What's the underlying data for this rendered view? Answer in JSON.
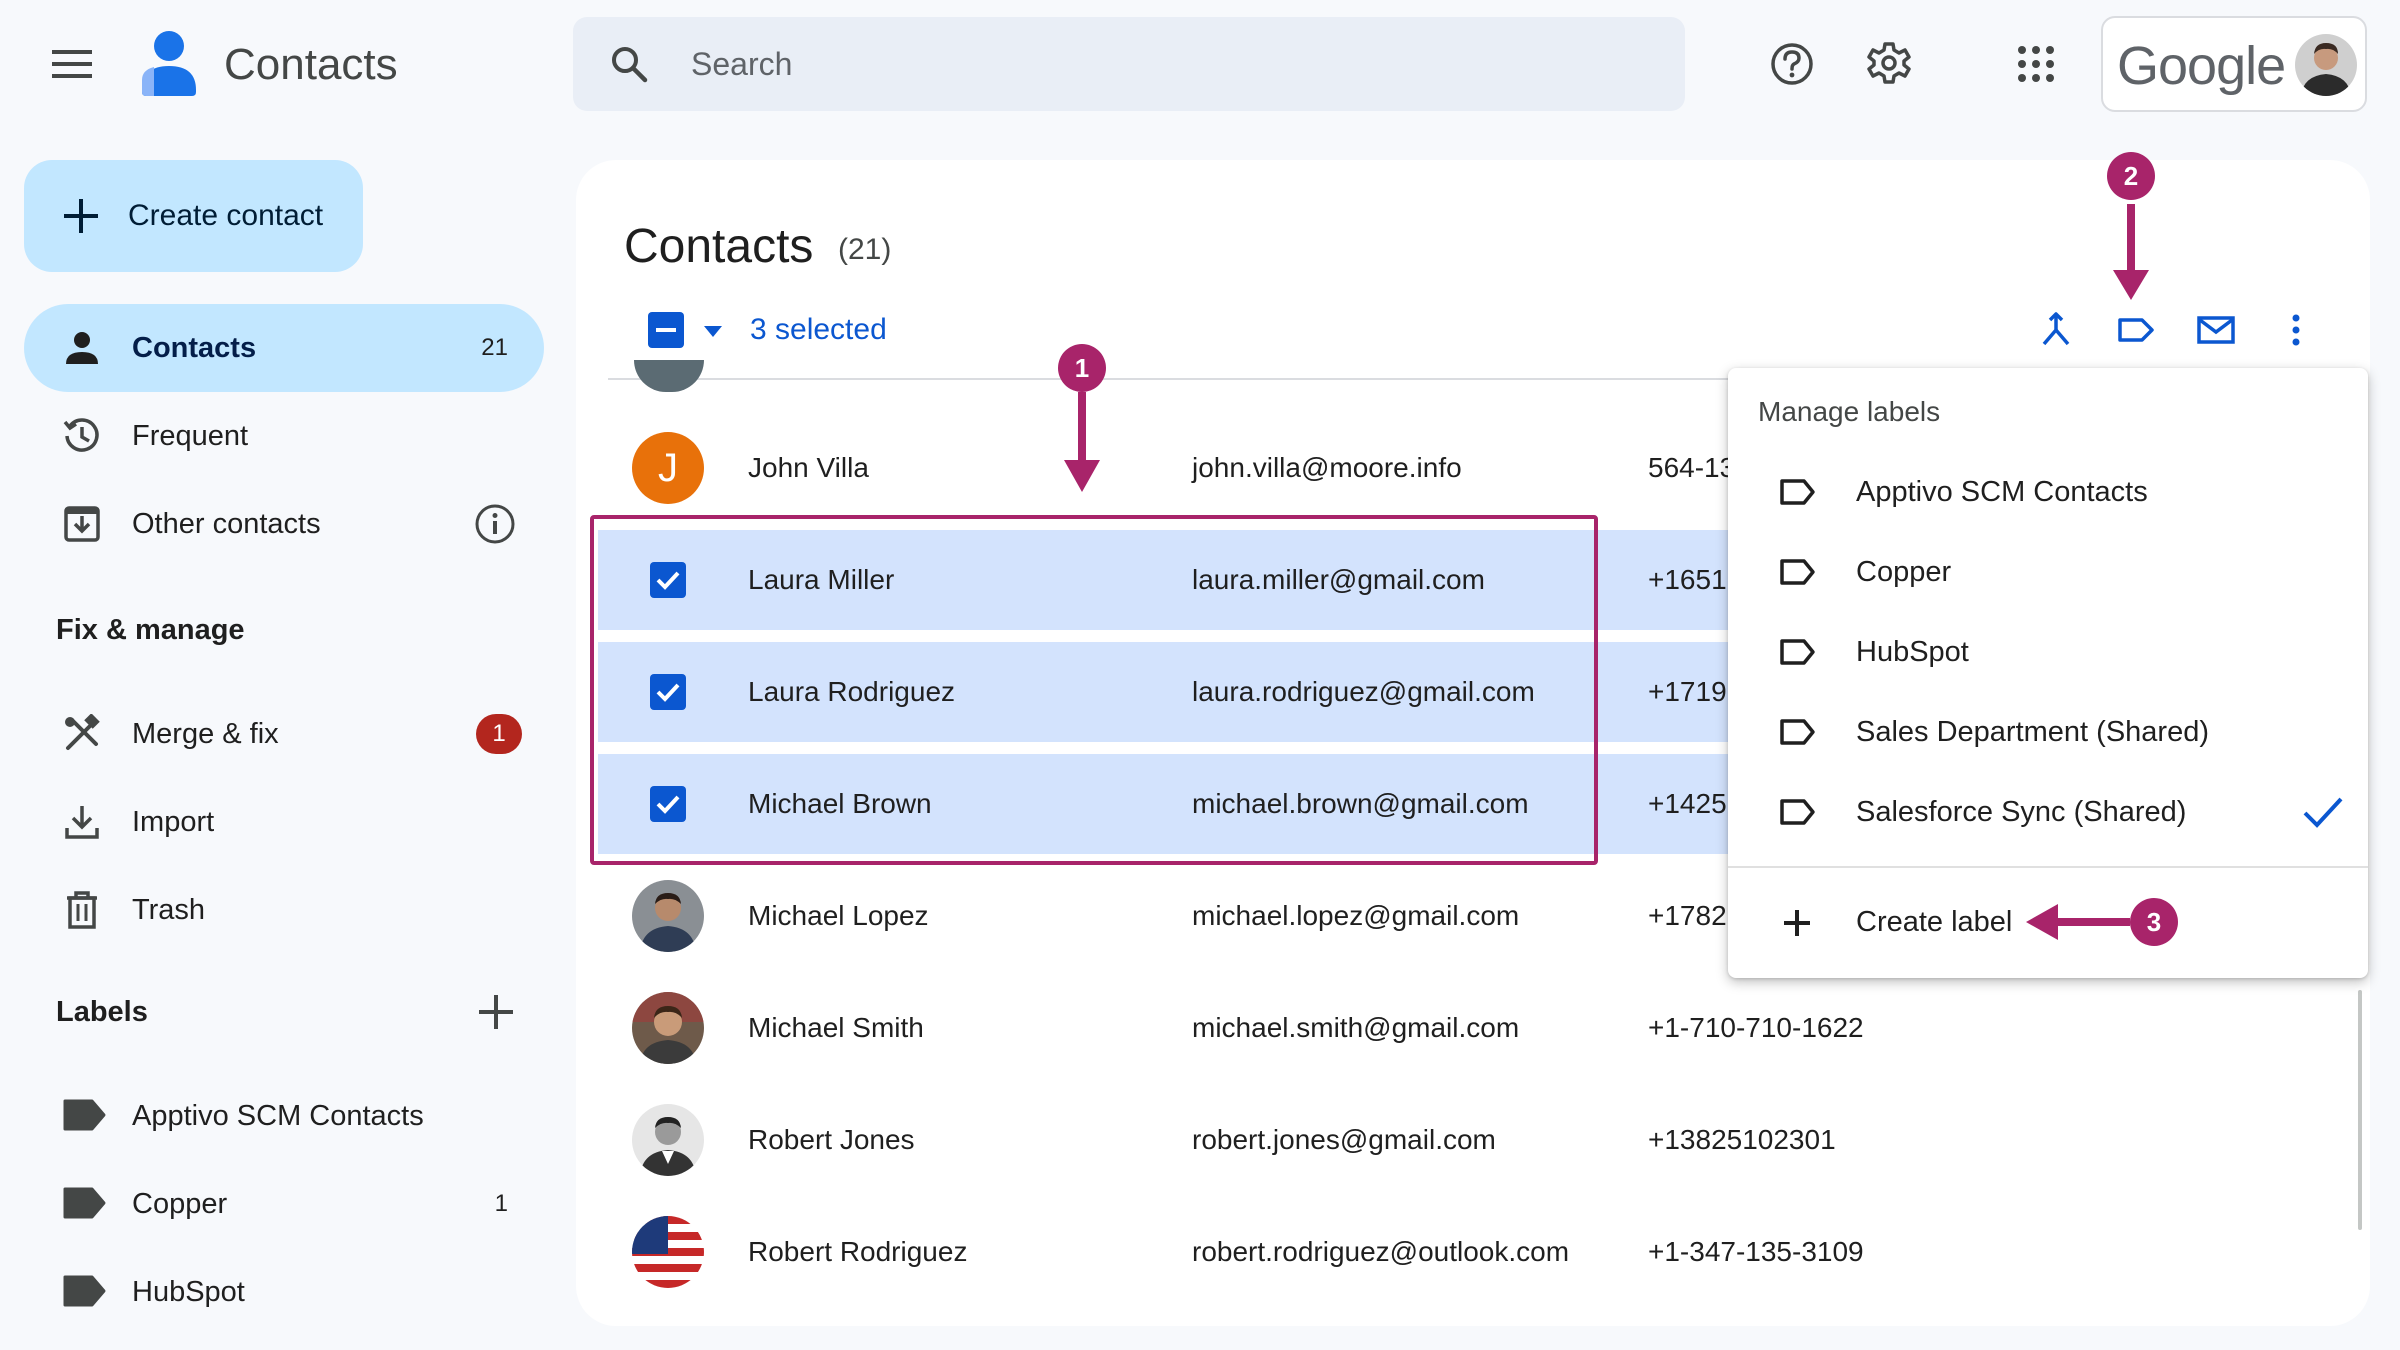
{
  "header": {
    "app_title": "Contacts",
    "search_placeholder": "Search",
    "google_wordmark": "Google"
  },
  "sidebar": {
    "create_label": "Create contact",
    "nav": [
      {
        "label": "Contacts",
        "count": "21",
        "icon": "person-icon",
        "active": true
      },
      {
        "label": "Frequent",
        "icon": "history-icon"
      },
      {
        "label": "Other contacts",
        "icon": "download-box-icon"
      }
    ],
    "fix_manage_heading": "Fix & manage",
    "manage": [
      {
        "label": "Merge & fix",
        "badge": "1",
        "icon": "merge-tools-icon"
      },
      {
        "label": "Import",
        "icon": "import-icon"
      },
      {
        "label": "Trash",
        "icon": "trash-icon"
      }
    ],
    "labels_heading": "Labels",
    "labels": [
      {
        "label": "Apptivo SCM Contacts",
        "count": ""
      },
      {
        "label": "Copper",
        "count": "1"
      },
      {
        "label": "HubSpot",
        "count": ""
      }
    ]
  },
  "main": {
    "title": "Contacts",
    "count": "(21)",
    "selected_text": "3 selected",
    "rows": [
      {
        "initial": "J",
        "name": "John Villa",
        "email": "john.villa@moore.info",
        "phone": "564-13",
        "selected": false,
        "avatar_color": "#e8710a"
      },
      {
        "name": "Laura Miller",
        "email": "laura.miller@gmail.com",
        "phone": "+1651",
        "selected": true
      },
      {
        "name": "Laura Rodriguez",
        "email": "laura.rodriguez@gmail.com",
        "phone": "+1719",
        "selected": true
      },
      {
        "name": "Michael Brown",
        "email": "michael.brown@gmail.com",
        "phone": "+1425",
        "selected": true
      },
      {
        "name": "Michael Lopez",
        "email": "michael.lopez@gmail.com",
        "phone": "+1782",
        "selected": false
      },
      {
        "name": "Michael Smith",
        "email": "michael.smith@gmail.com",
        "phone": "+1-710-710-1622",
        "selected": false
      },
      {
        "name": "Robert Jones",
        "email": "robert.jones@gmail.com",
        "phone": "+13825102301",
        "selected": false
      },
      {
        "name": "Robert Rodriguez",
        "email": "robert.rodriguez@outlook.com",
        "phone": "+1-347-135-3109",
        "selected": false
      }
    ]
  },
  "menu": {
    "title": "Manage labels",
    "items": [
      {
        "label": "Apptivo SCM Contacts",
        "checked": false
      },
      {
        "label": "Copper",
        "checked": false
      },
      {
        "label": "HubSpot",
        "checked": false
      },
      {
        "label": "Sales Department (Shared)",
        "checked": false
      },
      {
        "label": "Salesforce Sync (Shared)",
        "checked": true
      }
    ],
    "create_label": "Create label"
  },
  "annotations": {
    "step1": "1",
    "step2": "2",
    "step3": "3"
  },
  "colors": {
    "accent": "#0b57d0",
    "annotation": "#a8246a",
    "selected_row": "#d3e3fd",
    "nav_active": "#c2e7ff"
  }
}
